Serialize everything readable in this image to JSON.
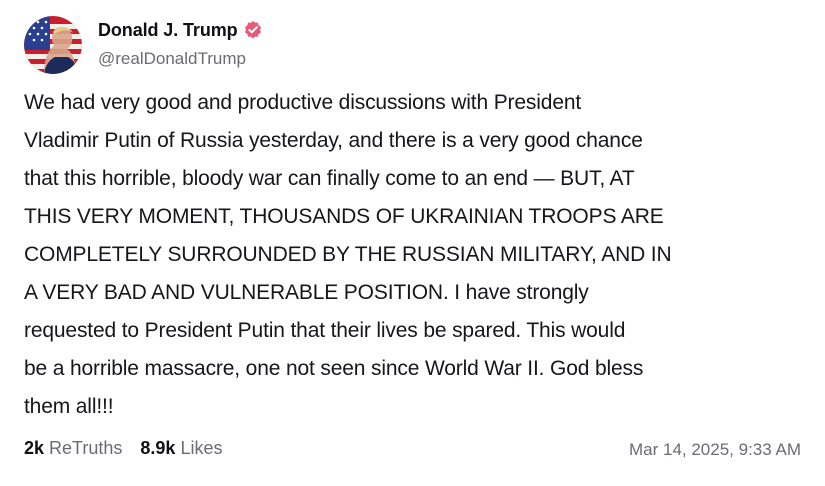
{
  "post": {
    "author": {
      "display_name": "Donald J. Trump",
      "handle": "@realDonaldTrump",
      "verified": true,
      "verified_color": "#e8597a",
      "avatar_icon": "flag-portrait-avatar"
    },
    "body_lines": [
      "We had very good and productive discussions with President",
      "Vladimir Putin of Russia yesterday, and there is a very good chance",
      "that this horrible, bloody war can finally come to an end — BUT, AT",
      "THIS VERY MOMENT, THOUSANDS OF UKRAINIAN TROOPS ARE",
      "COMPLETELY SURROUNDED BY THE RUSSIAN MILITARY, AND IN",
      "A VERY BAD AND VULNERABLE POSITION. I have strongly",
      "requested to President Putin that their lives be spared. This would",
      "be a horrible massacre, one not seen since World War II. God bless",
      "them all!!!"
    ],
    "stats": {
      "retruths_count": "2k",
      "retruths_label": "ReTruths",
      "likes_count": "8.9k",
      "likes_label": "Likes"
    },
    "timestamp": "Mar 14, 2025, 9:33 AM"
  }
}
